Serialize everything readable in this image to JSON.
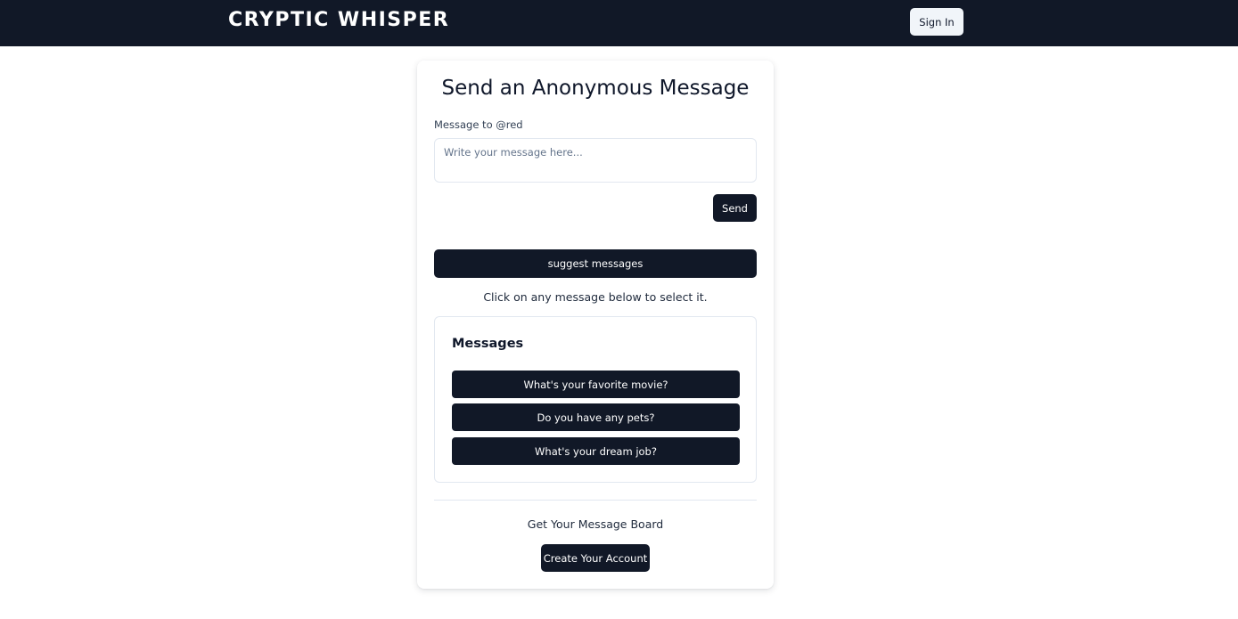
{
  "navbar": {
    "brand": "CRYPTIC WHISPER",
    "signin_label": "Sign In"
  },
  "card": {
    "title": "Send an Anonymous Message",
    "field_label": "Message to @red",
    "input_placeholder": "Write your message here...",
    "input_value": "",
    "send_label": "Send",
    "suggest_label": "suggest messages",
    "hint": "Click on any message below to select it.",
    "messages": {
      "heading": "Messages",
      "items": [
        "What's your favorite movie?",
        "Do you have any pets?",
        "What's your dream job?"
      ]
    },
    "board_text": "Get Your Message Board",
    "create_label": "Create Your Account"
  },
  "colors": {
    "navbar_bg": "#111827",
    "button_bg": "#111827",
    "signin_bg": "#f1f5f9",
    "border": "#e2e8f0"
  }
}
